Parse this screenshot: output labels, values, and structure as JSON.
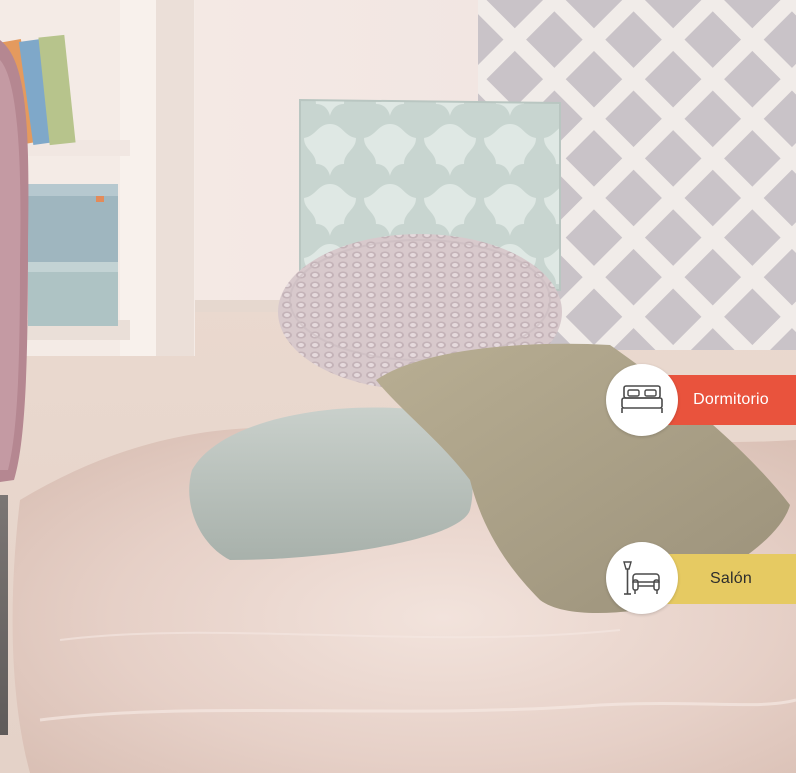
{
  "categories": [
    {
      "label": "Dormitorio",
      "icon": "bed-icon",
      "color": "#e9533d"
    },
    {
      "label": "Salón",
      "icon": "armchair-lamp-icon",
      "color": "#e6ca62"
    }
  ]
}
